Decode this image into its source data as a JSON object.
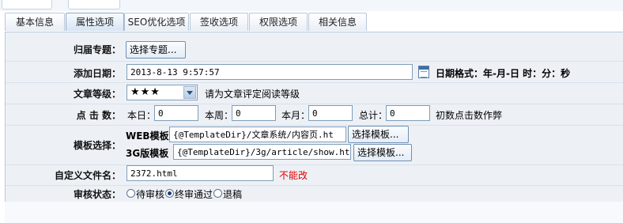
{
  "tabs": [
    "基本信息",
    "属性选项",
    "SEO优化选项",
    "签收选项",
    "权限选项",
    "相关信息"
  ],
  "active_tab": "属性选项",
  "form": {
    "topic": {
      "label": "归届专题：",
      "button": "选择专题..."
    },
    "add_date": {
      "label": "添加日期：",
      "value": "2013-8-13 9:57:57",
      "format_hint": "日期格式：年-月-日 时：分：秒"
    },
    "rating": {
      "label": "文章等级：",
      "value": "★★★",
      "hint": "请为文章评定阅读等级"
    },
    "clicks": {
      "label": "点 击 数：",
      "day_label": "本日：",
      "day_value": "0",
      "week_label": "本周：",
      "week_value": "0",
      "month_label": "本月：",
      "month_value": "0",
      "total_label": "总计：",
      "total_value": "0",
      "note": "初数点击数作弊"
    },
    "template": {
      "label": "模板选择：",
      "web_label": "WEB模板",
      "web_value": "{@TemplateDir}/文章系统/内容页.ht",
      "web_button": "选择模板...",
      "g3_label": "3G版模板",
      "g3_value": "{@TemplateDir}/3g/article/show.ht",
      "g3_button": "选择模板..."
    },
    "filename": {
      "label": "自定义文件名：",
      "value": "2372.html",
      "note": "不能改"
    },
    "review": {
      "label": "审核状态：",
      "options": [
        "待审核",
        "终审通过",
        "退稿"
      ],
      "selected": "终审通过"
    }
  }
}
